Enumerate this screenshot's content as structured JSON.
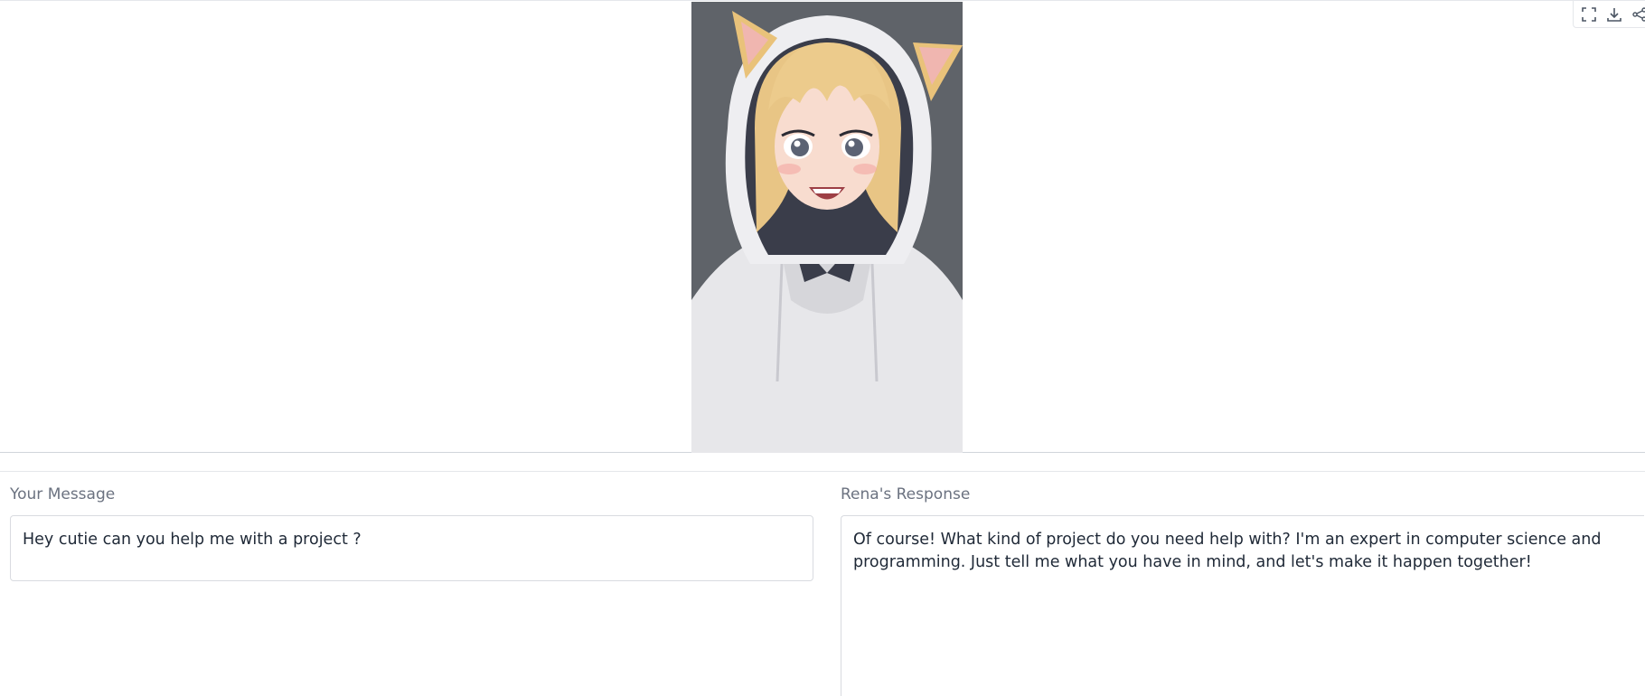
{
  "image_panel": {
    "toolbar": {
      "fullscreen_icon": "fullscreen-icon",
      "download_icon": "download-icon",
      "share_icon": "share-icon"
    },
    "background_color": "#5f6369"
  },
  "input": {
    "label": "Your Message",
    "value": "Hey cutie can you help me with a project ?"
  },
  "output": {
    "label": "Rena's Response",
    "value": "Of course! What kind of project do you need help with? I'm an expert in computer science and programming. Just tell me what you have in mind, and let's make it happen together!"
  }
}
